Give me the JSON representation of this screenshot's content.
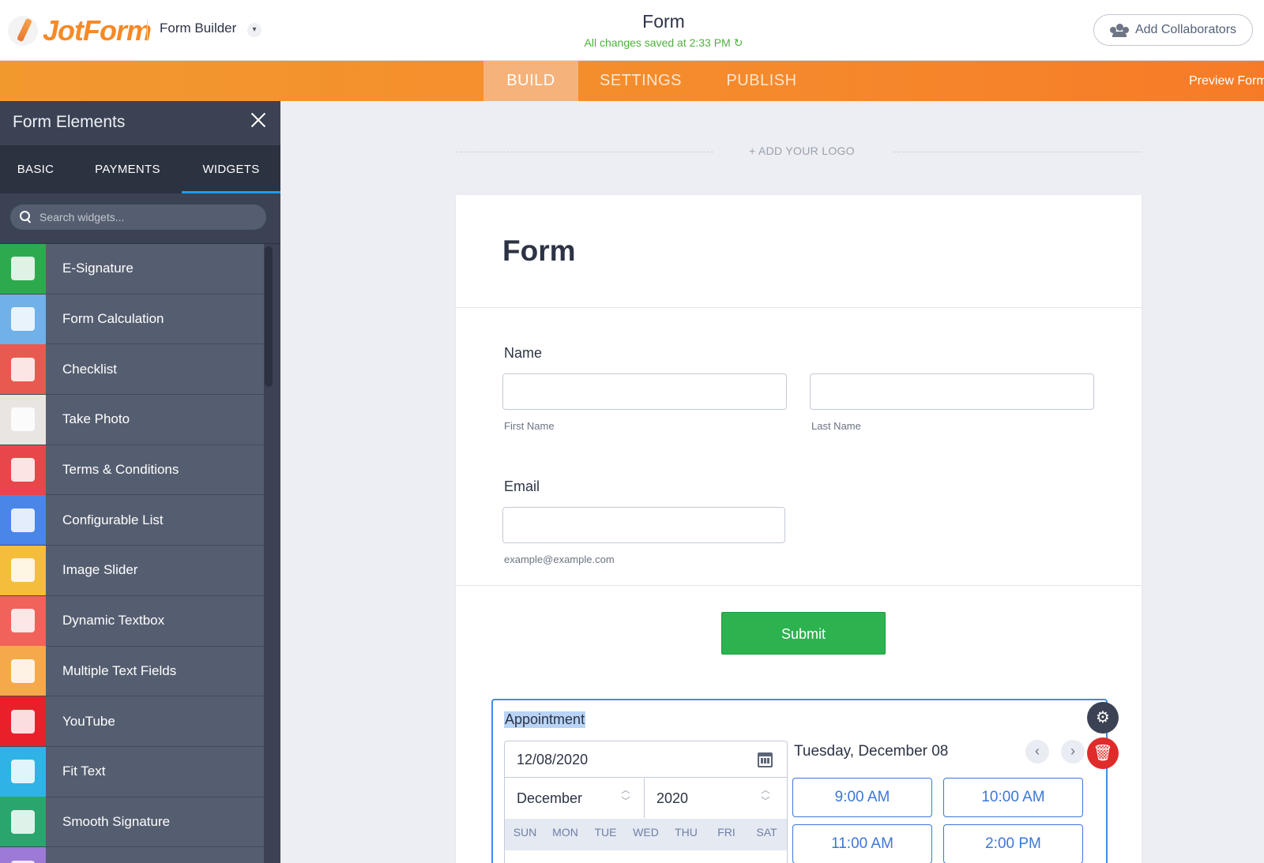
{
  "header": {
    "logo_text": "JotForm",
    "app_mode": "Form Builder",
    "doc_title": "Form",
    "save_status": "All changes saved at 2:33 PM",
    "collaborators_label": "Add Collaborators"
  },
  "nav": {
    "tabs": [
      {
        "label": "BUILD",
        "active": true
      },
      {
        "label": "SETTINGS",
        "active": false
      },
      {
        "label": "PUBLISH",
        "active": false
      }
    ],
    "preview_label": "Preview Form"
  },
  "sidebar": {
    "title": "Form Elements",
    "tabs": [
      {
        "label": "BASIC",
        "active": false
      },
      {
        "label": "PAYMENTS",
        "active": false
      },
      {
        "label": "WIDGETS",
        "active": true
      }
    ],
    "search_placeholder": "Search widgets...",
    "items": [
      {
        "label": "E-Signature",
        "icon": "e-signature-icon",
        "color": "#2eaa4e"
      },
      {
        "label": "Form Calculation",
        "icon": "calculator-icon",
        "color": "#6fb1e8"
      },
      {
        "label": "Checklist",
        "icon": "checklist-icon",
        "color": "#e85a4f"
      },
      {
        "label": "Take Photo",
        "icon": "camera-icon",
        "color": "#e9e5e2"
      },
      {
        "label": "Terms & Conditions",
        "icon": "document-check-icon",
        "color": "#e8464a"
      },
      {
        "label": "Configurable List",
        "icon": "table-list-icon",
        "color": "#4a86e8"
      },
      {
        "label": "Image Slider",
        "icon": "image-slider-icon",
        "color": "#f4bd3c"
      },
      {
        "label": "Dynamic Textbox",
        "icon": "textbox-icon",
        "color": "#f0625a"
      },
      {
        "label": "Multiple Text Fields",
        "icon": "multi-text-icon",
        "color": "#f6a94a"
      },
      {
        "label": "YouTube",
        "icon": "youtube-icon",
        "color": "#e9202a"
      },
      {
        "label": "Fit Text",
        "icon": "fit-text-icon",
        "color": "#2fb3e6"
      },
      {
        "label": "Smooth Signature",
        "icon": "pen-signature-icon",
        "color": "#2aa56e"
      },
      {
        "label": "",
        "icon": "grid-icon",
        "color": "#9c7ad6"
      }
    ]
  },
  "canvas": {
    "add_logo": "+ ADD YOUR LOGO",
    "form_title": "Form",
    "name_label": "Name",
    "first_name_sub": "First Name",
    "last_name_sub": "Last Name",
    "email_label": "Email",
    "email_sub": "example@example.com",
    "submit_label": "Submit",
    "appointment": {
      "label": "Appointment",
      "date_value": "12/08/2020",
      "month": "December",
      "year": "2020",
      "weekdays": [
        "SUN",
        "MON",
        "TUE",
        "WED",
        "THU",
        "FRI",
        "SAT"
      ],
      "day_heading": "Tuesday, December 08",
      "slots": [
        "9:00 AM",
        "10:00 AM",
        "11:00 AM",
        "2:00 PM"
      ]
    }
  },
  "colors": {
    "brand_orange": "#f58a27",
    "submit_green": "#2cb34f",
    "accent_blue": "#3b8ee6",
    "saved_green": "#4db13c"
  }
}
